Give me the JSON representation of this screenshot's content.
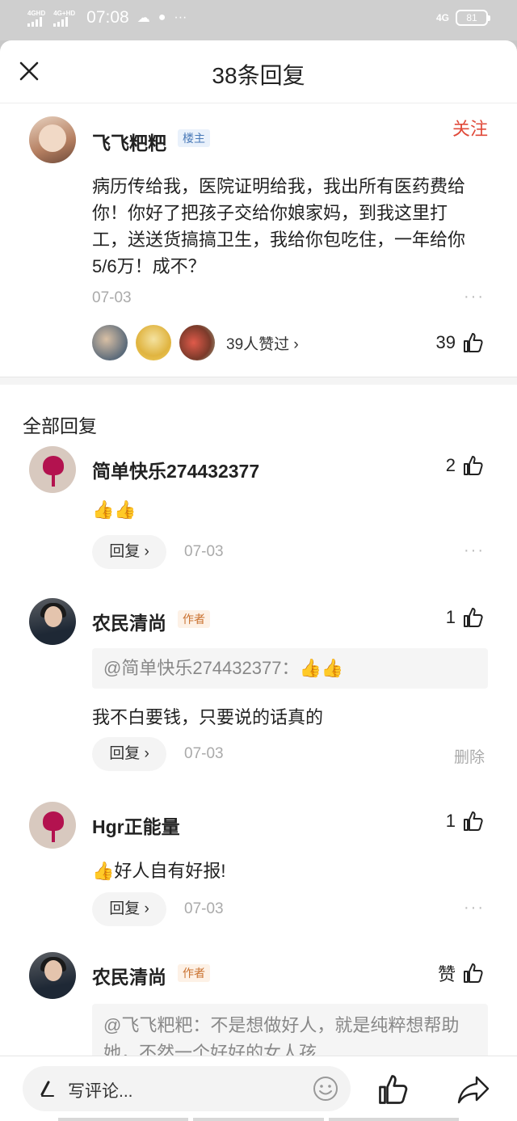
{
  "status_bar": {
    "sim1": "4GHD",
    "sim2": "4G+HD",
    "time": "07:08",
    "network": "4G",
    "battery": "81"
  },
  "header": {
    "title": "38条回复"
  },
  "main_post": {
    "author": "飞飞粑粑",
    "owner_badge": "楼主",
    "follow_label": "关注",
    "text": "病历传给我，医院证明给我，我出所有医药费给你！你好了把孩子交给你娘家妈，到我这里打工，送送货搞搞卫生，我给你包吃住，一年给你5/6万！成不？",
    "date": "07-03",
    "likers_text": "39人赞过",
    "like_count": "39"
  },
  "section_title": "全部回复",
  "replies": [
    {
      "author": "简单快乐274432377",
      "like_count": "2",
      "text": "👍👍",
      "reply_label": "回复",
      "date": "07-03"
    },
    {
      "author": "农民清尚",
      "author_badge": "作者",
      "like_count": "1",
      "quote": "@简单快乐274432377：👍👍",
      "text": "我不白要钱，只要说的话真的",
      "reply_label": "回复",
      "date": "07-03",
      "delete_label": "删除"
    },
    {
      "author": "Hgr正能量",
      "like_count": "1",
      "text": "👍好人自有好报!",
      "reply_label": "回复",
      "date": "07-03"
    },
    {
      "author": "农民清尚",
      "author_badge": "作者",
      "like_label": "赞",
      "quote": "@飞飞粑粑：不是想做好人，就是纯粹想帮助她，不然一个好好的女人孩"
    }
  ],
  "bottom_bar": {
    "placeholder": "写评论..."
  },
  "icons": {
    "close": "close-icon",
    "thumb": "thumb-up-icon",
    "more": "more-dots-icon",
    "pen": "pen-icon",
    "smile": "smile-icon",
    "share": "share-icon"
  }
}
